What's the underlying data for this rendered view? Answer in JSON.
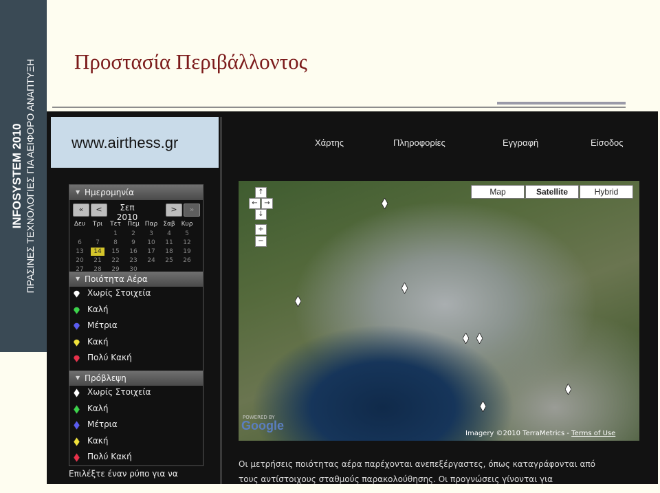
{
  "slide": {
    "side_title": "INFOSYSTEM  2010",
    "side_subtitle": "ΠΡΑΣΙΝΕΣ ΤΕΧΝΟΛΟΓΙΕΣ ΓΙΑ ΑΕΙΦΟΡΟ ΑΝΑΠΤΥΞΗ",
    "title": "Προστασία Περιβάλλοντος"
  },
  "site": {
    "logo": "www.airthess.gr",
    "nav": [
      "Χάρτης",
      "Πληροφορίες",
      "Εγγραφή",
      "Είσοδος"
    ]
  },
  "calendar": {
    "header": "Ημερομηνία",
    "prev_year": "«",
    "prev_month": "<",
    "month_label": "Σεπ 2010",
    "next_month": ">",
    "next_year": "»",
    "weekdays": [
      "Δευ",
      "Τρι",
      "Τετ",
      "Πεμ",
      "Παρ",
      "Σαβ",
      "Κυρ"
    ],
    "weeks": [
      [
        "",
        "",
        "1",
        "2",
        "3",
        "4",
        "5"
      ],
      [
        "6",
        "7",
        "8",
        "9",
        "10",
        "11",
        "12"
      ],
      [
        "13",
        "14",
        "15",
        "16",
        "17",
        "18",
        "19"
      ],
      [
        "20",
        "21",
        "22",
        "23",
        "24",
        "25",
        "26"
      ],
      [
        "27",
        "28",
        "29",
        "30",
        "",
        "",
        ""
      ]
    ],
    "selected_day": "14"
  },
  "air_quality": {
    "header": "Ποιότητα Αέρα",
    "items": [
      {
        "label": "Χωρίς Στοιχεία",
        "color": "#ffffff"
      },
      {
        "label": "Καλή",
        "color": "#3bd44a"
      },
      {
        "label": "Μέτρια",
        "color": "#5a5cf0"
      },
      {
        "label": "Κακή",
        "color": "#f0e23a"
      },
      {
        "label": "Πολύ Κακή",
        "color": "#e8304a"
      }
    ]
  },
  "forecast": {
    "header": "Πρόβλεψη",
    "items": [
      {
        "label": "Χωρίς Στοιχεία",
        "color": "#ffffff"
      },
      {
        "label": "Καλή",
        "color": "#3bd44a"
      },
      {
        "label": "Μέτρια",
        "color": "#5a5cf0"
      },
      {
        "label": "Κακή",
        "color": "#f0e23a"
      },
      {
        "label": "Πολύ Κακή",
        "color": "#e8304a"
      }
    ]
  },
  "hint": "Επιλέξτε έναν ρύπο για να",
  "map": {
    "types": [
      "Map",
      "Satellite",
      "Hybrid"
    ],
    "active_type": "Satellite",
    "pan_up": "↑",
    "pan_left": "←",
    "pan_right": "→",
    "pan_down": "↓",
    "zoom_in": "+",
    "zoom_out": "−",
    "powered_by": "POWERED BY",
    "google": "Google",
    "attribution": "Imagery ©2010 TerraMetrics - ",
    "terms": "Terms of Use"
  },
  "description": [
    "Οι μετρήσεις ποιότητας αέρα παρέχονται ανεπεξέργαστες, όπως καταγράφονται από",
    "τους αντίστοιχους σταθμούς παρακολούθησης. Οι προγνώσεις γίνονται για"
  ]
}
